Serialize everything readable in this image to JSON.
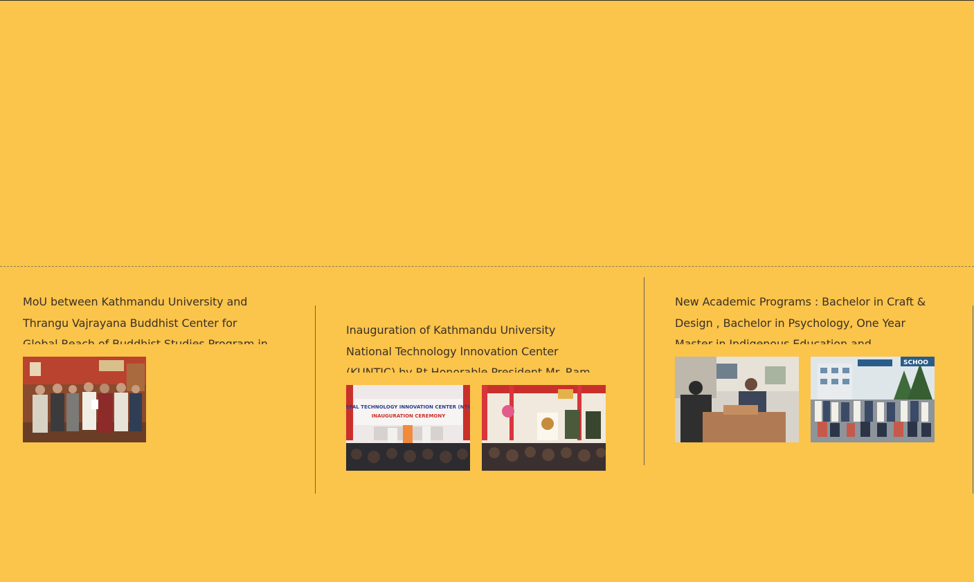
{
  "news": {
    "items": [
      {
        "title": "MoU between Kathmandu University and Thrangu Vajrayana Buddhist Center for Global Reach of Buddhist Studies Program in Hong Kong",
        "images": [
          {
            "alt": "MoU signing ceremony photo",
            "icon": "photo-mou-signing"
          }
        ]
      },
      {
        "title": "Inauguration of Kathmandu University National Technology Innovation Center (KUNTIC) by Rt.Honorable President Mr. Ram Chandra Poudel",
        "images": [
          {
            "alt": "NTIC inauguration ceremony stage photo",
            "icon": "photo-inauguration-stage",
            "banner_line1": "NEPAL TECHNOLOGY INNOVATION CENTER (NTIC)",
            "banner_line2": "INAUGURATION CEREMONY"
          },
          {
            "alt": "President addressing the audience photo",
            "icon": "photo-president-speech"
          }
        ]
      },
      {
        "title": "New Academic Programs : Bachelor in Craft & Design , Bachelor in Psychology, One Year Master in Indigenous Education and",
        "images": [
          {
            "alt": "Craft workshop photo",
            "icon": "photo-craft-workshop"
          },
          {
            "alt": "School of Education group photo",
            "icon": "photo-group-school",
            "sign_text": "SCHOO"
          }
        ]
      }
    ]
  },
  "colors": {
    "background": "#fbc44b",
    "text": "#3a3126",
    "divider": "#8a7a57"
  }
}
